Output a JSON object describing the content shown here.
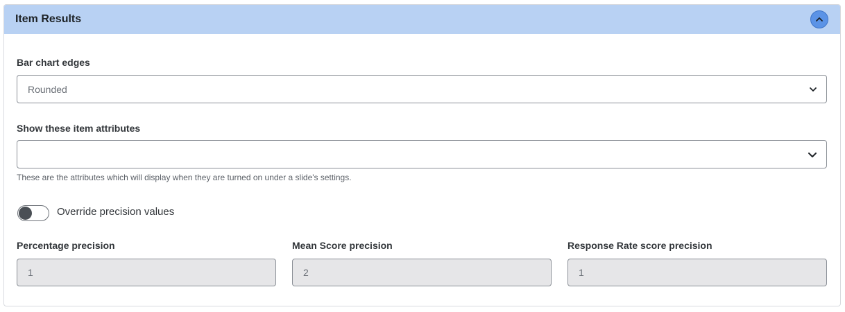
{
  "header": {
    "title": "Item Results",
    "collapse_icon": "chevron-up-icon",
    "accent": "#b8d1f3"
  },
  "bar_chart_edges": {
    "label": "Bar chart edges",
    "value": "Rounded"
  },
  "item_attributes": {
    "label": "Show these item attributes",
    "value": "",
    "help": "These are the attributes which will display when they are turned on under a slide's settings."
  },
  "override": {
    "label": "Override precision values",
    "enabled": false
  },
  "precision": {
    "percentage": {
      "label": "Percentage precision",
      "value": "1"
    },
    "mean_score": {
      "label": "Mean Score precision",
      "value": "2"
    },
    "response_rate": {
      "label": "Response Rate score precision",
      "value": "1"
    }
  }
}
